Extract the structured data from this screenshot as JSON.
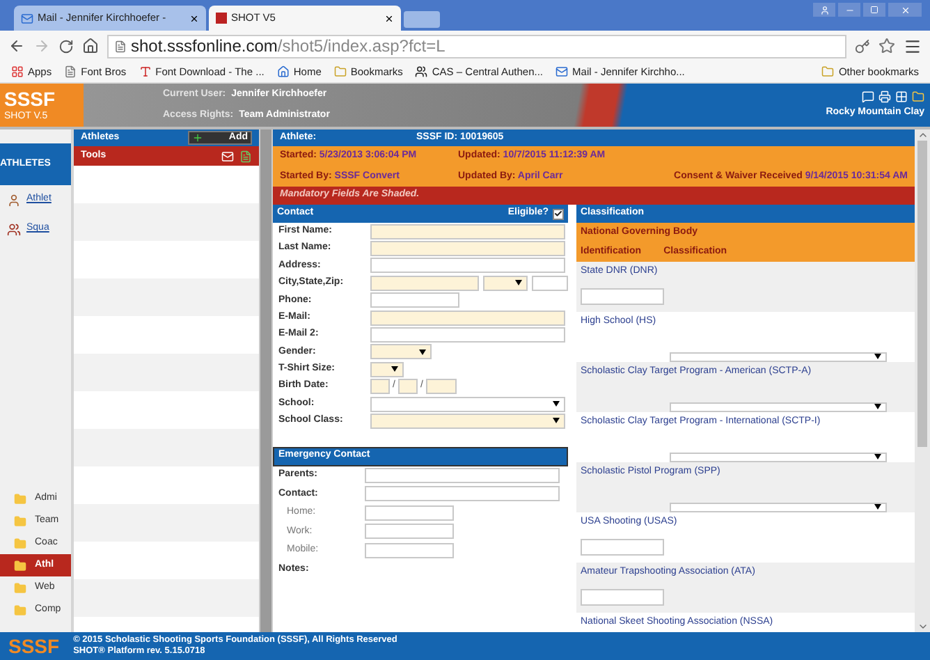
{
  "browser": {
    "tabs": [
      {
        "title": "Mail - Jennifer Kirchhoefer - ",
        "selected": false,
        "kind": "mail"
      },
      {
        "title": "SHOT V5",
        "selected": true,
        "kind": "site"
      }
    ],
    "url": {
      "host": "shot.sssfonline.com",
      "path": "/shot5/index.asp?fct=L"
    },
    "bookmarks": [
      {
        "label": "Apps",
        "kind": "apps"
      },
      {
        "label": "Font Bros",
        "kind": "page"
      },
      {
        "label": "Font Download - The ...",
        "kind": "font"
      },
      {
        "label": "Home",
        "kind": "home"
      },
      {
        "label": "Bookmarks",
        "kind": "folder"
      },
      {
        "label": "CAS – Central Authen...",
        "kind": "cas"
      },
      {
        "label": "Mail - Jennifer Kirchho...",
        "kind": "mail"
      }
    ],
    "other_bookmarks": "Other bookmarks"
  },
  "header": {
    "logo": "SSSF",
    "version": "SHOT V.5",
    "user_label": "Current User:",
    "user": "Jennifer Kirchhoefer",
    "rights_label": "Access Rights:",
    "rights": "Team Administrator",
    "org": "Rocky Mountain Clay"
  },
  "nav": {
    "title": "ATHLETES",
    "links": [
      {
        "label": "Athlet",
        "kind": "person"
      },
      {
        "label": "Squa",
        "kind": "squad"
      }
    ],
    "modules": [
      {
        "label": "Admi",
        "selected": false
      },
      {
        "label": "Team",
        "selected": false
      },
      {
        "label": "Coac",
        "selected": false
      },
      {
        "label": "Athl",
        "selected": true
      },
      {
        "label": "Web",
        "selected": false
      },
      {
        "label": "Comp",
        "selected": false
      }
    ]
  },
  "athletes_panel": {
    "title": "Athletes",
    "add": "Add",
    "tools": "Tools"
  },
  "athlete": {
    "label": "Athlete:",
    "id_label": "SSSF ID:",
    "id": "10019605",
    "info": [
      {
        "label": "Started:",
        "value": "5/23/2013 3:06:04 PM"
      },
      {
        "label": "Updated:",
        "value": "10/7/2015 11:12:39 AM"
      },
      {
        "label": "Started By:",
        "value": "SSSF Convert"
      },
      {
        "label": "Updated By:",
        "value": "April Carr"
      },
      {
        "label": "Consent & Waiver Received",
        "value": "9/14/2015 10:31:54 AM"
      }
    ],
    "notice": "Mandatory Fields Are Shaded."
  },
  "contact": {
    "title": "Contact",
    "eligible_label": "Eligible?",
    "eligible": true,
    "fields": [
      {
        "label": "First Name:",
        "kind": "text",
        "mandatory": true
      },
      {
        "label": "Last Name:",
        "kind": "text",
        "mandatory": true
      },
      {
        "label": "Address:",
        "kind": "text",
        "mandatory": false
      },
      {
        "label": "City,State,Zip:",
        "kind": "citystatezip",
        "mandatory": true
      },
      {
        "label": "Phone:",
        "kind": "shorttext",
        "mandatory": false
      },
      {
        "label": "E-Mail:",
        "kind": "text",
        "mandatory": true
      },
      {
        "label": "E-Mail 2:",
        "kind": "text",
        "mandatory": false
      },
      {
        "label": "Gender:",
        "kind": "smallselect",
        "mandatory": true
      },
      {
        "label": "T-Shirt Size:",
        "kind": "tinyselect",
        "mandatory": true
      },
      {
        "label": "Birth Date:",
        "kind": "date",
        "mandatory": true,
        "separator": "/"
      },
      {
        "label": "School:",
        "kind": "select",
        "mandatory": false
      },
      {
        "label": "School Class:",
        "kind": "select",
        "mandatory": true
      }
    ]
  },
  "emergency": {
    "title": "Emergency Contact",
    "fields": [
      {
        "label": "Parents:",
        "kind": "text",
        "sub": false
      },
      {
        "label": "Contact:",
        "kind": "text",
        "sub": false
      },
      {
        "label": "Home:",
        "kind": "shorttext",
        "sub": true
      },
      {
        "label": "Work:",
        "kind": "shorttext",
        "sub": true
      },
      {
        "label": "Mobile:",
        "kind": "shorttext",
        "sub": true
      },
      {
        "label": "Notes:",
        "kind": "label",
        "sub": false
      }
    ]
  },
  "classification": {
    "title": "Classification",
    "governing": "National Governing Body",
    "col_1": "Identification",
    "col_2": "Classification",
    "bodies": [
      {
        "label": "State DNR (DNR)",
        "kind": "text"
      },
      {
        "label": "High School (HS)",
        "kind": "select"
      },
      {
        "label": "Scholastic Clay Target Program - American (SCTP-A)",
        "kind": "select"
      },
      {
        "label": "Scholastic Clay Target Program - International (SCTP-I)",
        "kind": "select"
      },
      {
        "label": "Scholastic Pistol Program (SPP)",
        "kind": "select"
      },
      {
        "label": "USA Shooting (USAS)",
        "kind": "text"
      },
      {
        "label": "Amateur Trapshooting Association (ATA)",
        "kind": "text"
      },
      {
        "label": "National Skeet Shooting Association (NSSA)",
        "kind": "none"
      }
    ]
  },
  "footer": {
    "logo": "SSSF",
    "copyright": "© 2015 Scholastic Shooting Sports Foundation (SSSF), All Rights Reserved",
    "version": "SHOT® Platform rev. 5.15.0718"
  }
}
